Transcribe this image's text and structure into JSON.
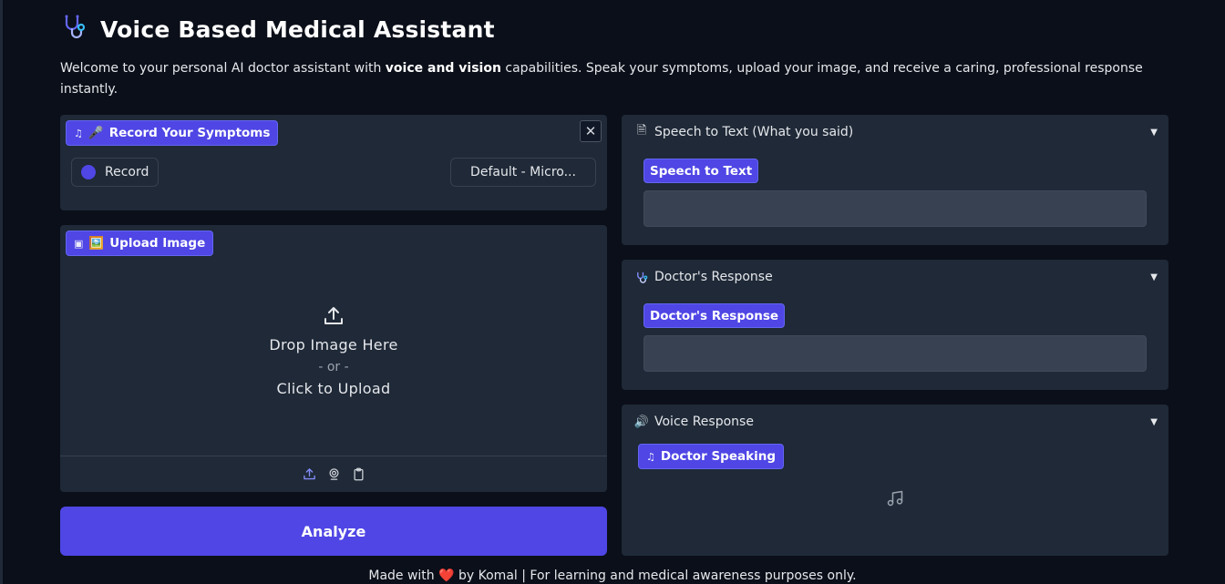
{
  "header": {
    "title": "Voice Based Medical Assistant",
    "icon": "stethoscope-icon"
  },
  "description": {
    "part1": "Welcome to your personal AI doctor assistant with ",
    "bold": "voice and vision",
    "part2": " capabilities. Speak your symptoms, upload your image, and receive a caring, professional response instantly."
  },
  "record_panel": {
    "chip_emoji": "🎤",
    "chip_label": "Record Your Symptoms",
    "record_label": "Record",
    "mic_select_value": "Default - Micro...",
    "close_symbol": "✕"
  },
  "upload_panel": {
    "chip_emoji": "🖼️",
    "chip_label": "Upload Image",
    "drop_text": "Drop Image Here",
    "or_text": "- or -",
    "click_text": "Click to Upload"
  },
  "analyze": {
    "label": "Analyze"
  },
  "speech_panel": {
    "header": "Speech to Text (What you said)",
    "chip_label": "Speech to Text",
    "textbox_value": ""
  },
  "doctor_panel": {
    "header": "Doctor's Response",
    "chip_label": "Doctor's Response",
    "textbox_value": ""
  },
  "voice_panel": {
    "header": "Voice Response",
    "chip_label": "Doctor Speaking"
  },
  "footer": {
    "part1": "Made with ",
    "heart": "❤️",
    "part2": " by Komal | For learning and medical awareness purposes only."
  },
  "colors": {
    "background": "#0b0f19",
    "panel": "#1f2937",
    "accent": "#4f46e5",
    "textbox": "#374151"
  }
}
